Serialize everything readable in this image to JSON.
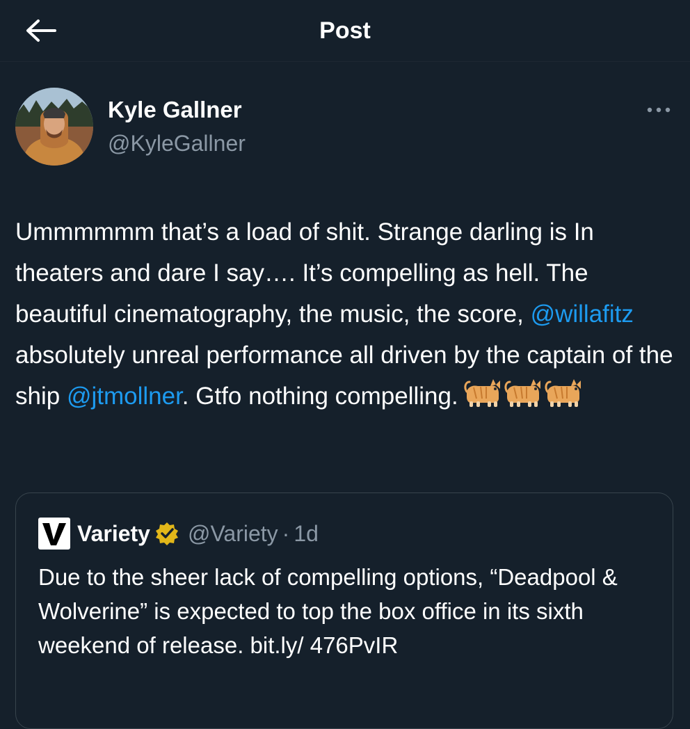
{
  "header": {
    "title": "Post",
    "back_icon": "arrow-left-icon"
  },
  "tweet": {
    "author": {
      "name": "Kyle Gallner",
      "handle": "@KyleGallner"
    },
    "more_icon": "more-horizontal-icon",
    "text_parts": {
      "p1": "Ummmmmm that’s a load of shit. Strange darling is In theaters and dare I say…. It’s compelling as hell. The beautiful cinematography, the music, the score, ",
      "mention1": "@willafitz",
      "p2": " absolutely unreal performance all driven by the captain of the ship ",
      "mention2": "@jtmollner",
      "p3": ". Gtfo nothing compelling.",
      "emoji": "🐈🐈🐈"
    }
  },
  "quote": {
    "name": "Variety",
    "handle": "@Variety",
    "separator": "·",
    "time": "1d",
    "verified_icon": "gold-verified-badge-icon",
    "logo_icon": "variety-logo-icon",
    "text": "Due to the sheer lack of compelling options, “Deadpool & Wolverine” is expected to top the box office in its sixth weekend of release. bit.ly/ 476PvIR"
  },
  "colors": {
    "background": "#15202b",
    "text": "#ffffff",
    "secondary_text": "#8b98a5",
    "link": "#1d9bf0",
    "border": "#38444d",
    "verified_gold": "#e2b719"
  }
}
